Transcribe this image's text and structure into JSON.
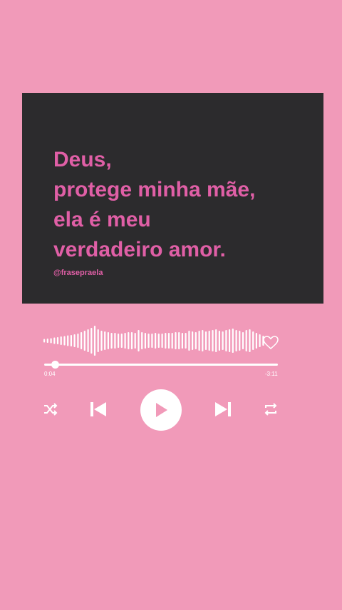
{
  "quote": {
    "lines": [
      "Deus,",
      "protege minha mãe,",
      "ela é meu",
      "verdadeiro amor."
    ],
    "handle": "@frasepraela"
  },
  "player": {
    "elapsed": "0:04",
    "remaining": "-3:11",
    "progress": 0.02,
    "liked": false,
    "icons": {
      "shuffle": "shuffle-icon",
      "previous": "skip-previous-icon",
      "play": "play-icon",
      "next": "skip-next-icon",
      "repeat": "repeat-icon",
      "like": "heart-icon"
    }
  },
  "colors": {
    "background": "#f19ab9",
    "card": "#2c2b2d",
    "accent": "#e05fa6",
    "foreground": "#ffffff"
  }
}
